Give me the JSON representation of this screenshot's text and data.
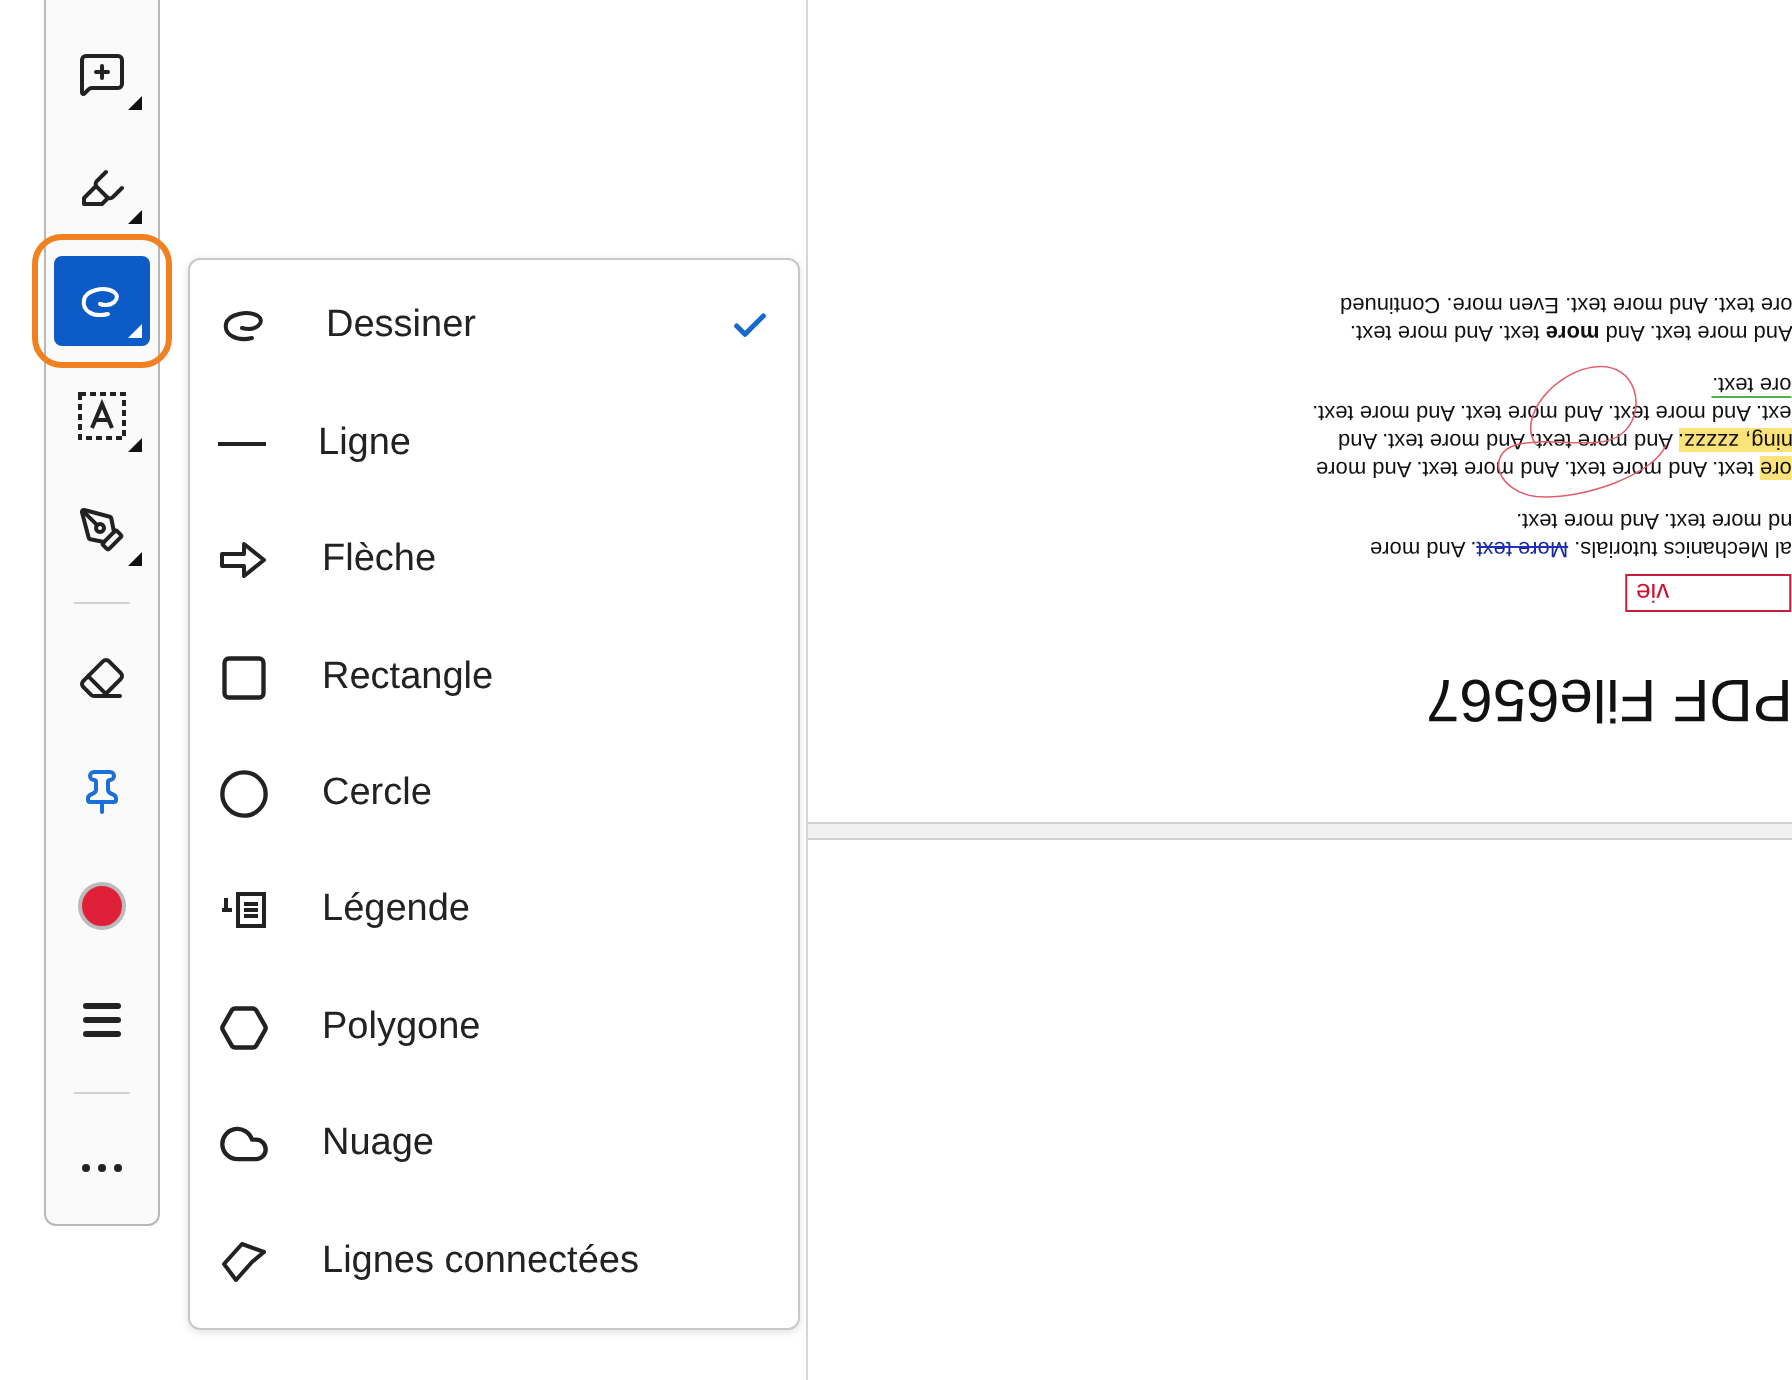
{
  "toolbar": {
    "tools": [
      {
        "kind": "comment",
        "selected": false,
        "submenu": true
      },
      {
        "kind": "highlight",
        "selected": false,
        "submenu": true
      },
      {
        "kind": "draw",
        "selected": true,
        "submenu": true
      },
      {
        "kind": "text",
        "selected": false,
        "submenu": true
      },
      {
        "kind": "sign",
        "selected": false,
        "submenu": true
      },
      {
        "kind": "divider"
      },
      {
        "kind": "eraser",
        "selected": false,
        "submenu": false
      },
      {
        "kind": "pin",
        "selected": false,
        "submenu": false
      },
      {
        "kind": "color",
        "selected": false,
        "submenu": false,
        "color": "#e02038"
      },
      {
        "kind": "stroke",
        "selected": false,
        "submenu": false
      },
      {
        "kind": "divider"
      },
      {
        "kind": "more",
        "selected": false,
        "submenu": false
      }
    ]
  },
  "draw_menu": {
    "items": [
      {
        "kind": "freehand",
        "label": "Dessiner",
        "selected": true
      },
      {
        "kind": "line",
        "label": "Ligne",
        "selected": false
      },
      {
        "kind": "arrow",
        "label": "Flèche",
        "selected": false
      },
      {
        "kind": "rectangle",
        "label": "Rectangle",
        "selected": false
      },
      {
        "kind": "circle",
        "label": "Cercle",
        "selected": false
      },
      {
        "kind": "callout",
        "label": "Légende",
        "selected": false
      },
      {
        "kind": "polygon",
        "label": "Polygone",
        "selected": false
      },
      {
        "kind": "cloud",
        "label": "Nuage",
        "selected": false
      },
      {
        "kind": "polyline",
        "label": "Lignes connectées",
        "selected": false
      }
    ]
  },
  "document": {
    "paragraphs": [
      {
        "lines": [
          {
            "segments": [
              {
                "kind": "plain",
                "text": "ore text. And more text. Even more. Continued"
              }
            ]
          },
          {
            "segments": [
              {
                "kind": "plain",
                "text": "And more text. And **more** text. And more text."
              }
            ]
          }
        ]
      },
      {
        "lines": [
          {
            "segments": [
              {
                "kind": "underline",
                "text": "ore text."
              }
            ]
          },
          {
            "segments": [
              {
                "kind": "plain",
                "text": "ext. And more text. And more text. And more text."
              }
            ]
          },
          {
            "segments": [
              {
                "kind": "highlight",
                "text": "ning, zzzzz."
              },
              {
                "kind": "plain",
                "text": " And more text. And more text. And"
              }
            ]
          },
          {
            "segments": [
              {
                "kind": "highlight",
                "text": "ore"
              },
              {
                "kind": "plain",
                "text": " text. And more text. And more text. And more"
              }
            ]
          }
        ]
      },
      {
        "lines": [
          {
            "segments": [
              {
                "kind": "plain",
                "text": "nd more text. And more text."
              }
            ]
          },
          {
            "segments": [
              {
                "kind": "plain",
                "text": "al Mechanics tutorials. "
              },
              {
                "kind": "strike",
                "text": "More text"
              },
              {
                "kind": "plain",
                "text": ". And more"
              }
            ]
          }
        ]
      }
    ],
    "note": "vie",
    "title": "PDF File6567"
  }
}
